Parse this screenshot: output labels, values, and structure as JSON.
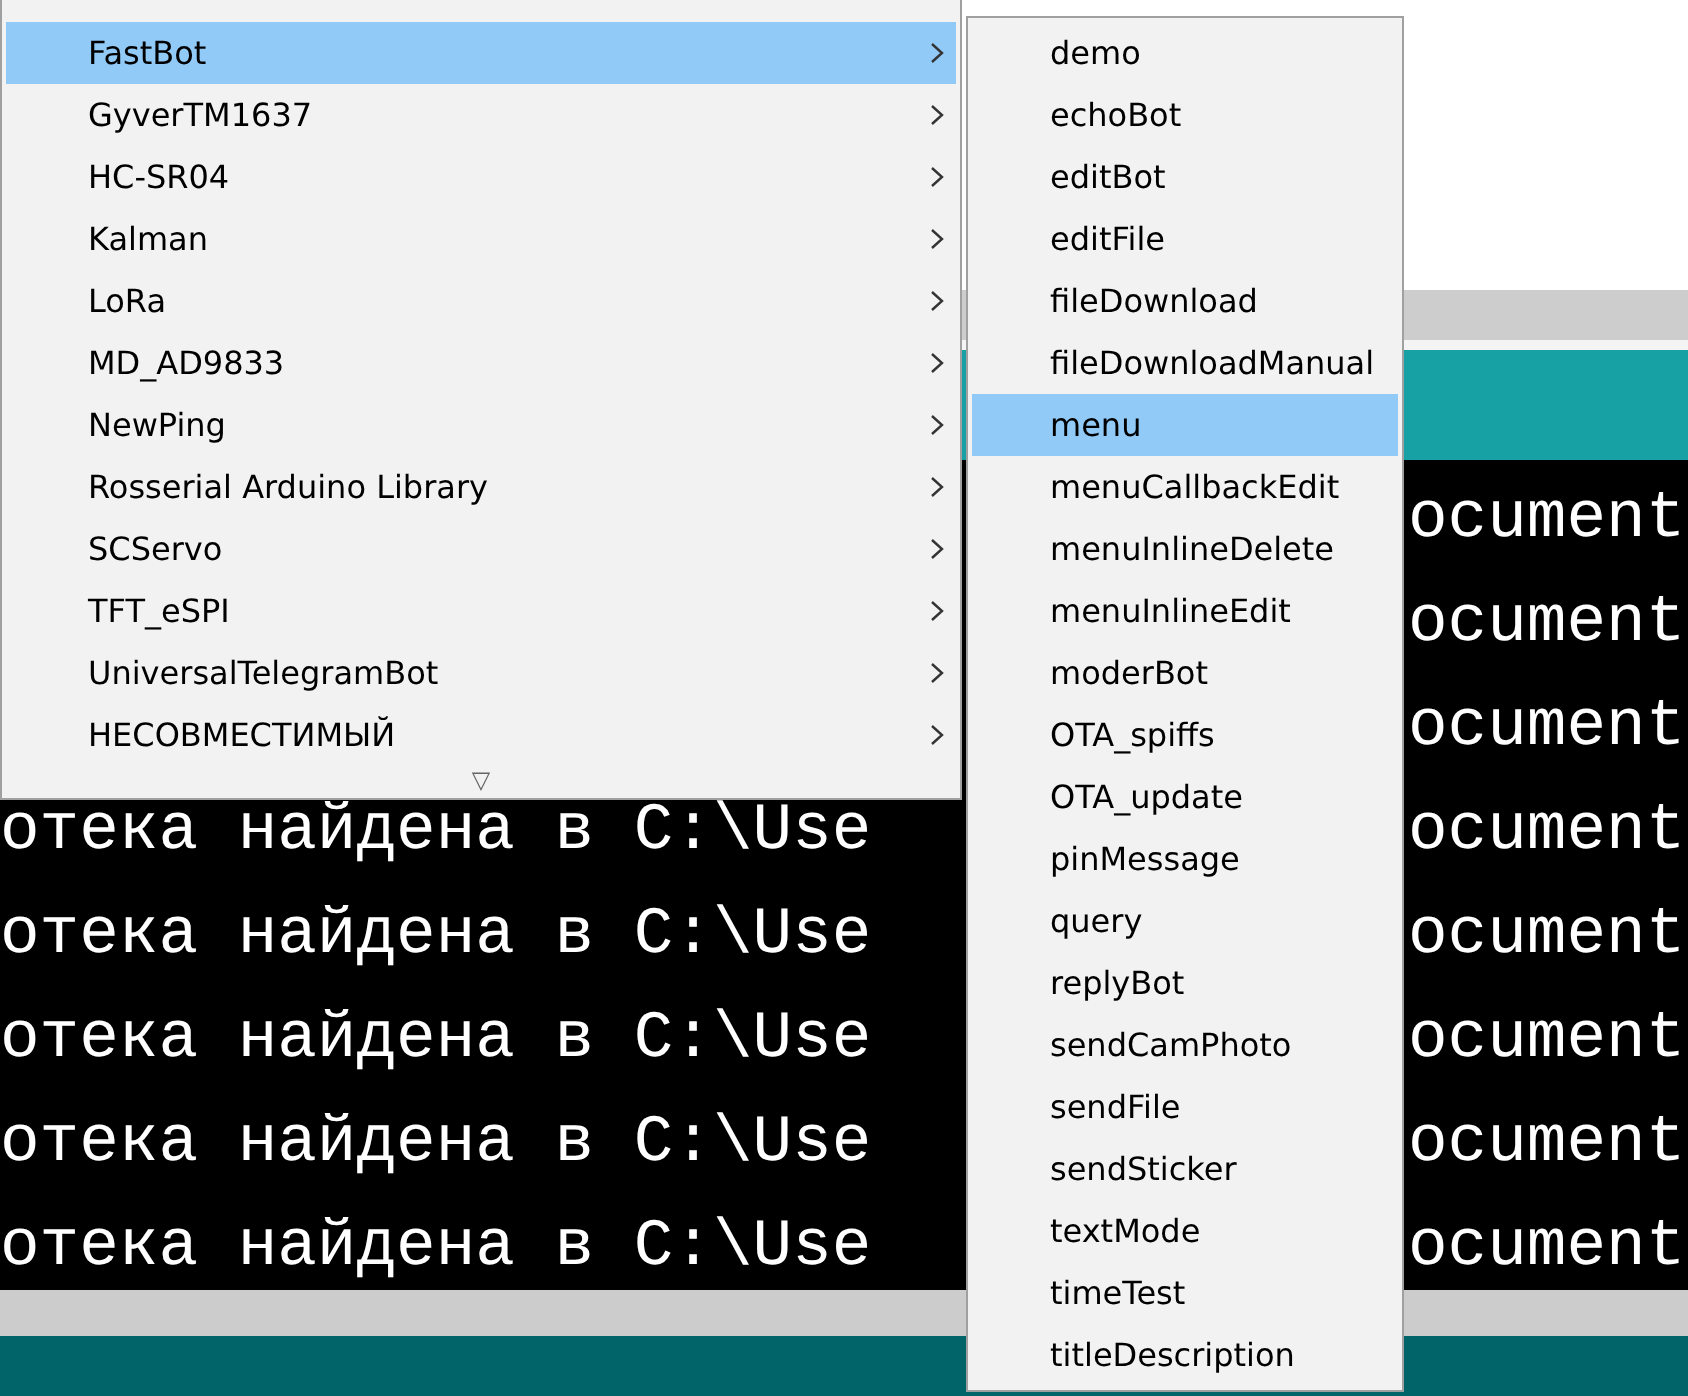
{
  "menu": {
    "items": [
      {
        "label": "FastBot",
        "selected": true
      },
      {
        "label": "GyverTM1637",
        "selected": false
      },
      {
        "label": "HC-SR04",
        "selected": false
      },
      {
        "label": "Kalman",
        "selected": false
      },
      {
        "label": "LoRa",
        "selected": false
      },
      {
        "label": "MD_AD9833",
        "selected": false
      },
      {
        "label": "NewPing",
        "selected": false
      },
      {
        "label": "Rosserial Arduino Library",
        "selected": false
      },
      {
        "label": "SCServo",
        "selected": false
      },
      {
        "label": "TFT_eSPI",
        "selected": false
      },
      {
        "label": "UniversalTelegramBot",
        "selected": false
      },
      {
        "label": "НЕСОВМЕСТИМЫЙ",
        "selected": false
      }
    ],
    "scroll_indicator": "▽"
  },
  "submenu": {
    "items": [
      {
        "label": "demo",
        "selected": false
      },
      {
        "label": "echoBot",
        "selected": false
      },
      {
        "label": "editBot",
        "selected": false
      },
      {
        "label": "editFile",
        "selected": false
      },
      {
        "label": "fileDownload",
        "selected": false
      },
      {
        "label": "fileDownloadManual",
        "selected": false
      },
      {
        "label": "menu",
        "selected": true
      },
      {
        "label": "menuCallbackEdit",
        "selected": false
      },
      {
        "label": "menuInlineDelete",
        "selected": false
      },
      {
        "label": "menuInlineEdit",
        "selected": false
      },
      {
        "label": "moderBot",
        "selected": false
      },
      {
        "label": "OTA_spiffs",
        "selected": false
      },
      {
        "label": "OTA_update",
        "selected": false
      },
      {
        "label": "pinMessage",
        "selected": false
      },
      {
        "label": "query",
        "selected": false
      },
      {
        "label": "replyBot",
        "selected": false
      },
      {
        "label": "sendCamPhoto",
        "selected": false
      },
      {
        "label": "sendFile",
        "selected": false
      },
      {
        "label": "sendSticker",
        "selected": false
      },
      {
        "label": "textMode",
        "selected": false
      },
      {
        "label": "timeTest",
        "selected": false
      },
      {
        "label": "titleDescription",
        "selected": false
      }
    ]
  },
  "console": {
    "lines": [
      {
        "right": "ocument"
      },
      {
        "right": "ocument"
      },
      {
        "right": "ocument"
      },
      {
        "left": "отека найдена в C:\\Use",
        "right": "ocument"
      },
      {
        "left": "отека найдена в C:\\Use",
        "right": "ocument"
      },
      {
        "left": "отека найдена в C:\\Use",
        "right": "ocument"
      },
      {
        "left": "отека найдена в C:\\Use",
        "right": "ocument"
      },
      {
        "left": "отека найдена в C:\\Use",
        "right": "ocument"
      }
    ]
  }
}
